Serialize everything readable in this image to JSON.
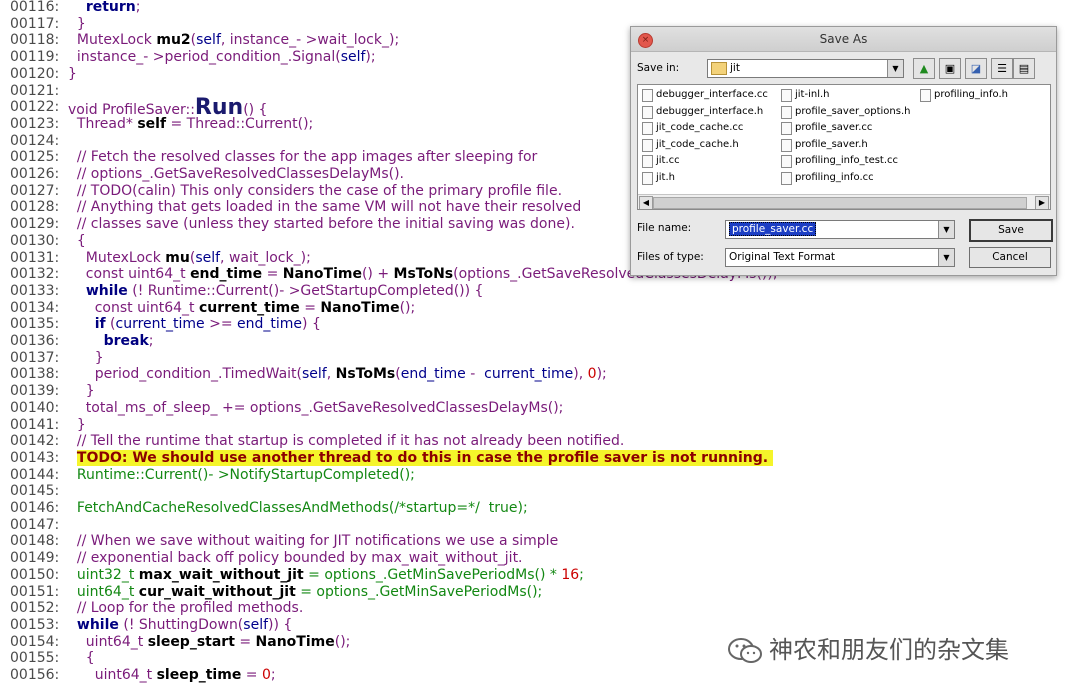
{
  "code_lines": [
    {
      "num": "00116:",
      "segments": [
        {
          "t": "    ",
          "c": "plain"
        },
        {
          "t": "return",
          "c": "kw"
        },
        {
          "t": ";",
          "c": "plain"
        }
      ]
    },
    {
      "num": "00117:",
      "segments": [
        {
          "t": "  }",
          "c": "plain"
        }
      ]
    },
    {
      "num": "00118:",
      "segments": [
        {
          "t": "  MutexLock ",
          "c": "plain"
        },
        {
          "t": "mu2",
          "c": "bold"
        },
        {
          "t": "(",
          "c": "plain"
        },
        {
          "t": "self",
          "c": "str"
        },
        {
          "t": ", instance_- >wait_lock_);",
          "c": "plain"
        }
      ]
    },
    {
      "num": "00119:",
      "segments": [
        {
          "t": "  instance_- >period_condition_.Signal(",
          "c": "plain"
        },
        {
          "t": "self",
          "c": "str"
        },
        {
          "t": ");",
          "c": "plain"
        }
      ]
    },
    {
      "num": "00120:",
      "segments": [
        {
          "t": "}",
          "c": "plain"
        }
      ]
    },
    {
      "num": "00121:",
      "segments": []
    },
    {
      "num": "00122:",
      "segments": [
        {
          "t": "void ProfileSaver::",
          "c": "plain"
        },
        {
          "t": "Run",
          "c": "big"
        },
        {
          "t": "() {",
          "c": "plain"
        }
      ]
    },
    {
      "num": "00123:",
      "segments": [
        {
          "t": "  Thread* ",
          "c": "plain"
        },
        {
          "t": "self",
          "c": "bold"
        },
        {
          "t": " = Thread::Current();",
          "c": "plain"
        }
      ]
    },
    {
      "num": "00124:",
      "segments": []
    },
    {
      "num": "00125:",
      "segments": [
        {
          "t": "  // Fetch the resolved classes for the app images after sleeping for",
          "c": "cmt"
        }
      ]
    },
    {
      "num": "00126:",
      "segments": [
        {
          "t": "  // options_.GetSaveResolvedClassesDelayMs().",
          "c": "cmt"
        }
      ]
    },
    {
      "num": "00127:",
      "segments": [
        {
          "t": "  // TODO(calin) This only considers the case of the primary profile file.",
          "c": "cmt"
        }
      ]
    },
    {
      "num": "00128:",
      "segments": [
        {
          "t": "  // Anything that gets loaded in the same VM will not have their resolved",
          "c": "cmt"
        }
      ]
    },
    {
      "num": "00129:",
      "segments": [
        {
          "t": "  // classes save (unless they started before the initial saving was done).",
          "c": "cmt"
        }
      ]
    },
    {
      "num": "00130:",
      "segments": [
        {
          "t": "  {",
          "c": "plain"
        }
      ]
    },
    {
      "num": "00131:",
      "segments": [
        {
          "t": "    MutexLock ",
          "c": "plain"
        },
        {
          "t": "mu",
          "c": "bold"
        },
        {
          "t": "(",
          "c": "plain"
        },
        {
          "t": "self",
          "c": "str"
        },
        {
          "t": ", wait_lock_);",
          "c": "plain"
        }
      ]
    },
    {
      "num": "00132:",
      "segments": [
        {
          "t": "    const uint64_t ",
          "c": "plain"
        },
        {
          "t": "end_time",
          "c": "bold"
        },
        {
          "t": " = ",
          "c": "plain"
        },
        {
          "t": "NanoTime",
          "c": "bold"
        },
        {
          "t": "() + ",
          "c": "plain"
        },
        {
          "t": "MsToNs",
          "c": "bold"
        },
        {
          "t": "(options_.GetSaveResolvedClassesDelayMs());",
          "c": "plain"
        }
      ]
    },
    {
      "num": "00133:",
      "segments": [
        {
          "t": "    ",
          "c": "plain"
        },
        {
          "t": "while",
          "c": "kw"
        },
        {
          "t": " (! Runtime::Current()- >GetStartupCompleted()) {",
          "c": "plain"
        }
      ]
    },
    {
      "num": "00134:",
      "segments": [
        {
          "t": "      const uint64_t ",
          "c": "plain"
        },
        {
          "t": "current_time",
          "c": "bold"
        },
        {
          "t": " = ",
          "c": "plain"
        },
        {
          "t": "NanoTime",
          "c": "bold"
        },
        {
          "t": "();",
          "c": "plain"
        }
      ]
    },
    {
      "num": "00135:",
      "segments": [
        {
          "t": "      ",
          "c": "plain"
        },
        {
          "t": "if",
          "c": "kw"
        },
        {
          "t": " (",
          "c": "plain"
        },
        {
          "t": "current_time",
          "c": "str"
        },
        {
          "t": " >= ",
          "c": "plain"
        },
        {
          "t": "end_time",
          "c": "str"
        },
        {
          "t": ") {",
          "c": "plain"
        }
      ]
    },
    {
      "num": "00136:",
      "segments": [
        {
          "t": "        ",
          "c": "plain"
        },
        {
          "t": "break",
          "c": "kw"
        },
        {
          "t": ";",
          "c": "plain"
        }
      ]
    },
    {
      "num": "00137:",
      "segments": [
        {
          "t": "      }",
          "c": "plain"
        }
      ]
    },
    {
      "num": "00138:",
      "segments": [
        {
          "t": "      period_condition_.TimedWait(",
          "c": "plain"
        },
        {
          "t": "self",
          "c": "str"
        },
        {
          "t": ", ",
          "c": "plain"
        },
        {
          "t": "NsToMs",
          "c": "bold"
        },
        {
          "t": "(",
          "c": "plain"
        },
        {
          "t": "end_time",
          "c": "str"
        },
        {
          "t": " -  ",
          "c": "plain"
        },
        {
          "t": "current_time",
          "c": "str"
        },
        {
          "t": "), ",
          "c": "plain"
        },
        {
          "t": "0",
          "c": "num-lit"
        },
        {
          "t": ");",
          "c": "plain"
        }
      ]
    },
    {
      "num": "00139:",
      "segments": [
        {
          "t": "    }",
          "c": "plain"
        }
      ]
    },
    {
      "num": "00140:",
      "segments": [
        {
          "t": "    total_ms_of_sleep_ += options_.GetSaveResolvedClassesDelayMs();",
          "c": "plain"
        }
      ]
    },
    {
      "num": "00141:",
      "segments": [
        {
          "t": "  }",
          "c": "plain"
        }
      ]
    },
    {
      "num": "00142:",
      "segments": [
        {
          "t": "  // Tell the runtime that startup is completed if it has not already been notified.",
          "c": "cmt"
        }
      ]
    },
    {
      "num": "00143:",
      "segments": [
        {
          "t": "  ",
          "c": "plain"
        },
        {
          "t": "TODO: We should use another thread to do this in case the profile saver is not running. ",
          "c": "hl"
        }
      ]
    },
    {
      "num": "00144:",
      "segments": [
        {
          "t": "  Runtime::Current()- >NotifyStartupCompleted();",
          "c": "grn"
        }
      ]
    },
    {
      "num": "00145:",
      "segments": []
    },
    {
      "num": "00146:",
      "segments": [
        {
          "t": "  FetchAndCacheResolvedClassesAndMethods(/*startup=*/  true);",
          "c": "grn"
        }
      ]
    },
    {
      "num": "00147:",
      "segments": []
    },
    {
      "num": "00148:",
      "segments": [
        {
          "t": "  // When we save without waiting for JIT notifications we use a simple",
          "c": "cmt"
        }
      ]
    },
    {
      "num": "00149:",
      "segments": [
        {
          "t": "  // exponential back off policy bounded by max_wait_without_jit.",
          "c": "cmt"
        }
      ]
    },
    {
      "num": "00150:",
      "segments": [
        {
          "t": "  uint32_t ",
          "c": "grn"
        },
        {
          "t": "max_wait_without_jit",
          "c": "bold"
        },
        {
          "t": " = options_.GetMinSavePeriodMs() * ",
          "c": "grn"
        },
        {
          "t": "16",
          "c": "num-lit"
        },
        {
          "t": ";",
          "c": "grn"
        }
      ]
    },
    {
      "num": "00151:",
      "segments": [
        {
          "t": "  uint64_t ",
          "c": "grn"
        },
        {
          "t": "cur_wait_without_jit",
          "c": "bold"
        },
        {
          "t": " = options_.GetMinSavePeriodMs();",
          "c": "grn"
        }
      ]
    },
    {
      "num": "00152:",
      "segments": [
        {
          "t": "  // Loop for the profiled methods.",
          "c": "cmt"
        }
      ]
    },
    {
      "num": "00153:",
      "segments": [
        {
          "t": "  ",
          "c": "plain"
        },
        {
          "t": "while",
          "c": "kw"
        },
        {
          "t": " (! ShuttingDown(",
          "c": "plain"
        },
        {
          "t": "self",
          "c": "str"
        },
        {
          "t": ")) {",
          "c": "plain"
        }
      ]
    },
    {
      "num": "00154:",
      "segments": [
        {
          "t": "    uint64_t ",
          "c": "plain"
        },
        {
          "t": "sleep_start",
          "c": "bold"
        },
        {
          "t": " = ",
          "c": "plain"
        },
        {
          "t": "NanoTime",
          "c": "bold"
        },
        {
          "t": "();",
          "c": "plain"
        }
      ]
    },
    {
      "num": "00155:",
      "segments": [
        {
          "t": "    {",
          "c": "plain"
        }
      ]
    },
    {
      "num": "00156:",
      "segments": [
        {
          "t": "      uint64_t ",
          "c": "plain"
        },
        {
          "t": "sleep_time",
          "c": "bold"
        },
        {
          "t": " = ",
          "c": "plain"
        },
        {
          "t": "0",
          "c": "num-lit"
        },
        {
          "t": ";",
          "c": "plain"
        }
      ]
    }
  ],
  "dialog": {
    "title": "Save As",
    "close_glyph": "×",
    "save_in_label": "Save in:",
    "save_in_value": "jit",
    "files_col1": [
      "debugger_interface.cc",
      "debugger_interface.h",
      "jit_code_cache.cc",
      "jit_code_cache.h",
      "jit.cc",
      "jit.h"
    ],
    "files_col2": [
      "jit-inl.h",
      "profile_saver_options.h",
      "profile_saver.cc",
      "profile_saver.h",
      "profiling_info_test.cc",
      "profiling_info.cc"
    ],
    "files_col3": [
      "profiling_info.h"
    ],
    "file_name_label": "File name:",
    "file_name_value": "profile_saver.cc",
    "files_of_type_label": "Files of type:",
    "files_of_type_value": "Original Text Format",
    "save_button": "Save",
    "cancel_button": "Cancel"
  },
  "watermark": {
    "text": "神农和朋友们的杂文集"
  }
}
